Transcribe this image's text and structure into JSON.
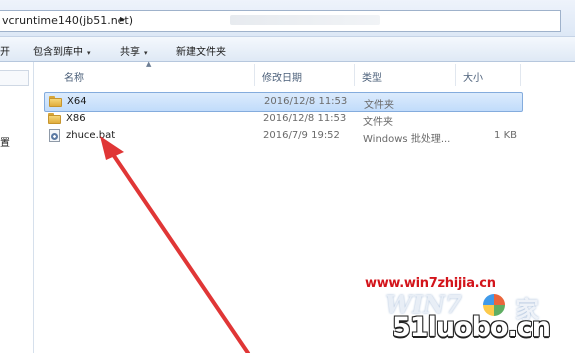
{
  "address_bar": {
    "path": "vcruntime140(jb51.net)",
    "chevron": "▸"
  },
  "toolbar": {
    "open_label": "开",
    "include_in_library_label": "包含到库中",
    "share_label": "共享",
    "new_folder_label": "新建文件夹",
    "caret": "▾"
  },
  "nav": {
    "partial_item": "置"
  },
  "columns": {
    "name": "名称",
    "date_modified": "修改日期",
    "type": "类型",
    "size": "大小",
    "sort_arrow": "▲"
  },
  "files": [
    {
      "name": "X64",
      "date": "2016/12/8 11:53",
      "type": "文件夹",
      "size": "",
      "icon": "folder-icon",
      "selected": true
    },
    {
      "name": "X86",
      "date": "2016/12/8 11:53",
      "type": "文件夹",
      "size": "",
      "icon": "folder-icon",
      "selected": false
    },
    {
      "name": "zhuce.bat",
      "date": "2016/7/9 19:52",
      "type": "Windows 批处理...",
      "size": "1 KB",
      "icon": "batch-file-icon",
      "selected": false
    }
  ],
  "watermarks": {
    "site": "www.win7zhijia.cn",
    "logo_win": "WIN7",
    "logo_jia": "家",
    "site2": "51luobo.cn"
  },
  "colors": {
    "annotation_arrow": "#e03636",
    "selection": "#c1dcfb",
    "watermark_red": "#d3141b"
  }
}
